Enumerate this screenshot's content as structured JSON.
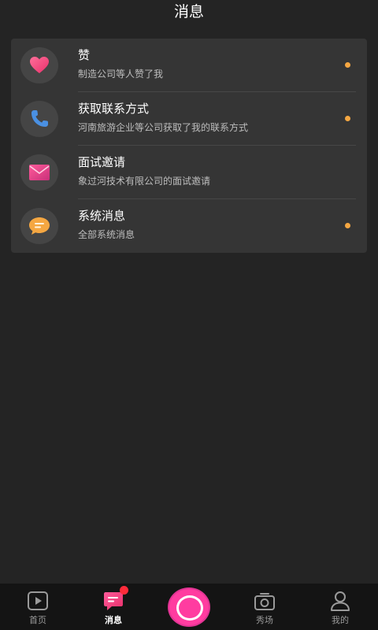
{
  "header": {
    "title": "消息"
  },
  "messages": [
    {
      "title": "赞",
      "desc": "制造公司等人赞了我",
      "unread": true,
      "icon": "heart-icon",
      "icon_color": "#f0407a"
    },
    {
      "title": "获取联系方式",
      "desc": "河南旅游企业等公司获取了我的联系方式",
      "unread": true,
      "icon": "phone-icon",
      "icon_color": "#4a90e2"
    },
    {
      "title": "面试邀请",
      "desc": "象过河技术有限公司的面试邀请",
      "unread": false,
      "icon": "mail-icon",
      "icon_color": "#e8408c"
    },
    {
      "title": "系统消息",
      "desc": "全部系统消息",
      "unread": true,
      "icon": "chat-bubble-icon",
      "icon_color": "#f5a742"
    }
  ],
  "tabbar": {
    "tabs": [
      {
        "label": "首页",
        "icon": "play-icon",
        "active": false
      },
      {
        "label": "消息",
        "icon": "message-icon",
        "active": true,
        "badge": true
      },
      {
        "label": "",
        "icon": "record-icon",
        "active": false
      },
      {
        "label": "秀场",
        "icon": "camera-icon",
        "active": false
      },
      {
        "label": "我的",
        "icon": "profile-icon",
        "active": false
      }
    ]
  },
  "colors": {
    "background": "#242424",
    "card": "#353535",
    "dot": "#f5a742",
    "accent": "#ff3ca0"
  }
}
